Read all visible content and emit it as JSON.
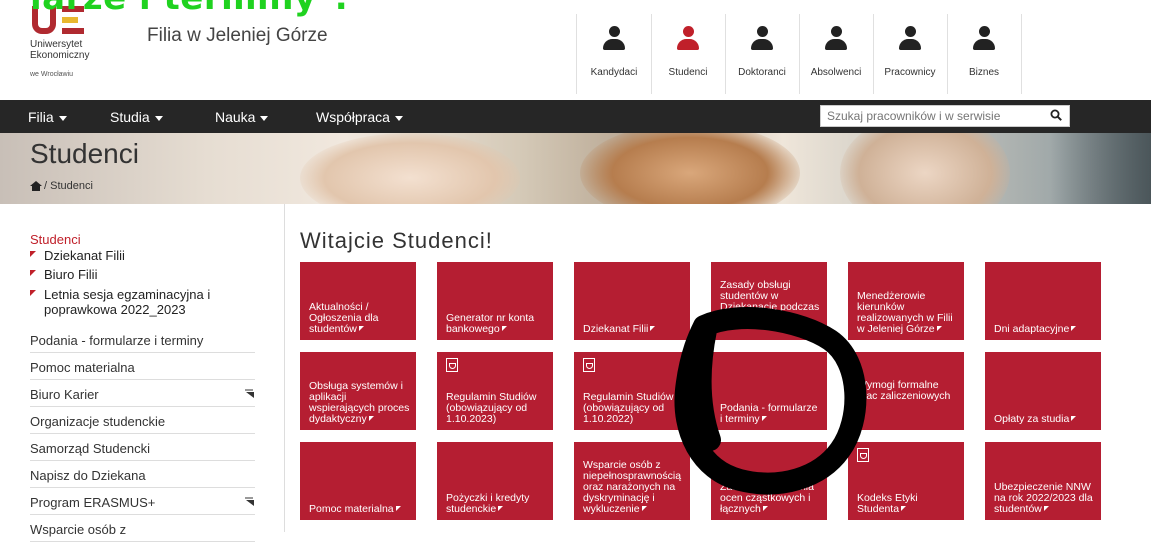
{
  "overlay": {
    "text": "iarze i terminy\"."
  },
  "header": {
    "logo": {
      "name_line1": "Uniwersytet",
      "name_line2": "Ekonomiczny",
      "city": "we Wrocławiu"
    },
    "branch": "Filia w Jeleniej Górze",
    "audience": [
      {
        "label": "Kandydaci",
        "icon": "candidate-icon"
      },
      {
        "label": "Studenci",
        "icon": "student-icon",
        "active": true
      },
      {
        "label": "Doktoranci",
        "icon": "doctoral-icon"
      },
      {
        "label": "Absolwenci",
        "icon": "graduate-icon"
      },
      {
        "label": "Pracownicy",
        "icon": "employee-icon"
      },
      {
        "label": "Biznes",
        "icon": "business-icon"
      }
    ]
  },
  "nav": {
    "items": [
      {
        "label": "Filia"
      },
      {
        "label": "Studia"
      },
      {
        "label": "Nauka"
      },
      {
        "label": "Współpraca"
      }
    ],
    "search_placeholder": "Szukaj pracowników i w serwisie"
  },
  "banner": {
    "title": "Studenci",
    "breadcrumb": "/ Studenci"
  },
  "sidebar": {
    "heading": "Studenci",
    "subitems": [
      {
        "label": "Dziekanat Filii"
      },
      {
        "label": "Biuro Filii"
      },
      {
        "label": "Letnia sesja egzaminacyjna i poprawkowa 2022_2023"
      }
    ],
    "items": [
      {
        "label": "Podania - formularze i terminy",
        "expandable": false
      },
      {
        "label": "Pomoc materialna",
        "expandable": false
      },
      {
        "label": "Biuro Karier",
        "expandable": true
      },
      {
        "label": "Organizacje studenckie",
        "expandable": false
      },
      {
        "label": "Samorząd Studencki",
        "expandable": false
      },
      {
        "label": "Napisz do Dziekana",
        "expandable": false
      },
      {
        "label": "Program ERASMUS+",
        "expandable": true
      },
      {
        "label": "Wsparcie osób z",
        "expandable": false
      }
    ]
  },
  "main": {
    "title": "Witajcie Studenci!",
    "tiles": [
      [
        {
          "text": "Aktualności / Ogłoszenia dla studentów"
        },
        {
          "text": "Generator nr konta bankowego"
        },
        {
          "text": "Dziekanat Filii"
        },
        {
          "text": "Zasady obsługi studentów w Dziekanacie podczas"
        },
        {
          "text": "Menedżerowie kierunków realizowanych w Filii w Jeleniej Górze"
        },
        {
          "text": "Dni adaptacyjne"
        }
      ],
      [
        {
          "text": "Obsługa systemów i aplikacji wspierających proces dydaktyczny"
        },
        {
          "text": "Regulamin Studiów (obowiązujący od 1.10.2023)",
          "pdf": true
        },
        {
          "text": "Regulamin Studiów (obowiązujący od 1.10.2022)",
          "pdf": true
        },
        {
          "text": "Podania - formularze i terminy"
        },
        {
          "text": "Wymogi formalne prac zaliczeniowych"
        },
        {
          "text": "Opłaty za studia"
        }
      ],
      [
        {
          "text": "Pomoc materialna"
        },
        {
          "text": "Pożyczki i kredyty studenckie"
        },
        {
          "text": "Wsparcie osób z niepełnosprawnością oraz narażonych na dyskryminację i wykluczenie"
        },
        {
          "text": "Zasady wystawiania ocen cząstkowych i łącznych"
        },
        {
          "text": "Kodeks Etyki Studenta",
          "pdf": true
        },
        {
          "text": "Ubezpieczenie NNW na rok 2022/2023 dla studentów"
        }
      ]
    ]
  },
  "colors": {
    "accent": "#b51e32",
    "nav_bg": "#262626",
    "overlay_green": "#1fd21f",
    "link_red": "#c0202a"
  }
}
